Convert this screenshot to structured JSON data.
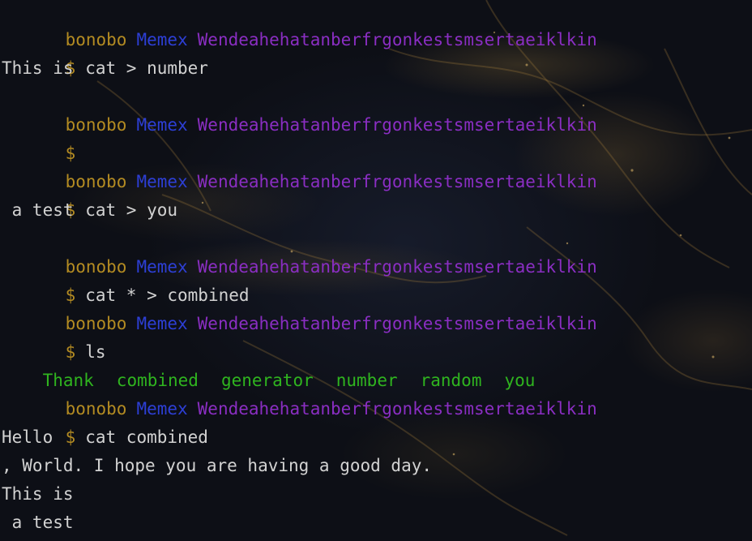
{
  "prompt": {
    "user": "bonobo",
    "host": "Memex",
    "path": "Wendeahehatanberfrgonkestsmsertaeiklkin",
    "symbol": "$"
  },
  "lines": {
    "l1_cmd": "cat > number",
    "l2_out": "This is",
    "l3_cmd": "",
    "l4_cmd": "cat > you",
    "l5_out": " a test",
    "l6_cmd": "cat * > combined",
    "l7_cmd": "ls",
    "l8_cmd": "cat combined",
    "l9_out": "Hello",
    "l10_out": ", World. I hope you are having a good day.",
    "l11_out": "This is",
    "l12_out": " a test"
  },
  "ls_output": [
    "Thank",
    "combined",
    "generator",
    "number",
    "random",
    "you"
  ],
  "colors": {
    "user": "#b38b22",
    "host": "#2d3fd6",
    "path": "#8a2ec2",
    "ls_green": "#2fb41f",
    "text": "#d2d2d2"
  }
}
